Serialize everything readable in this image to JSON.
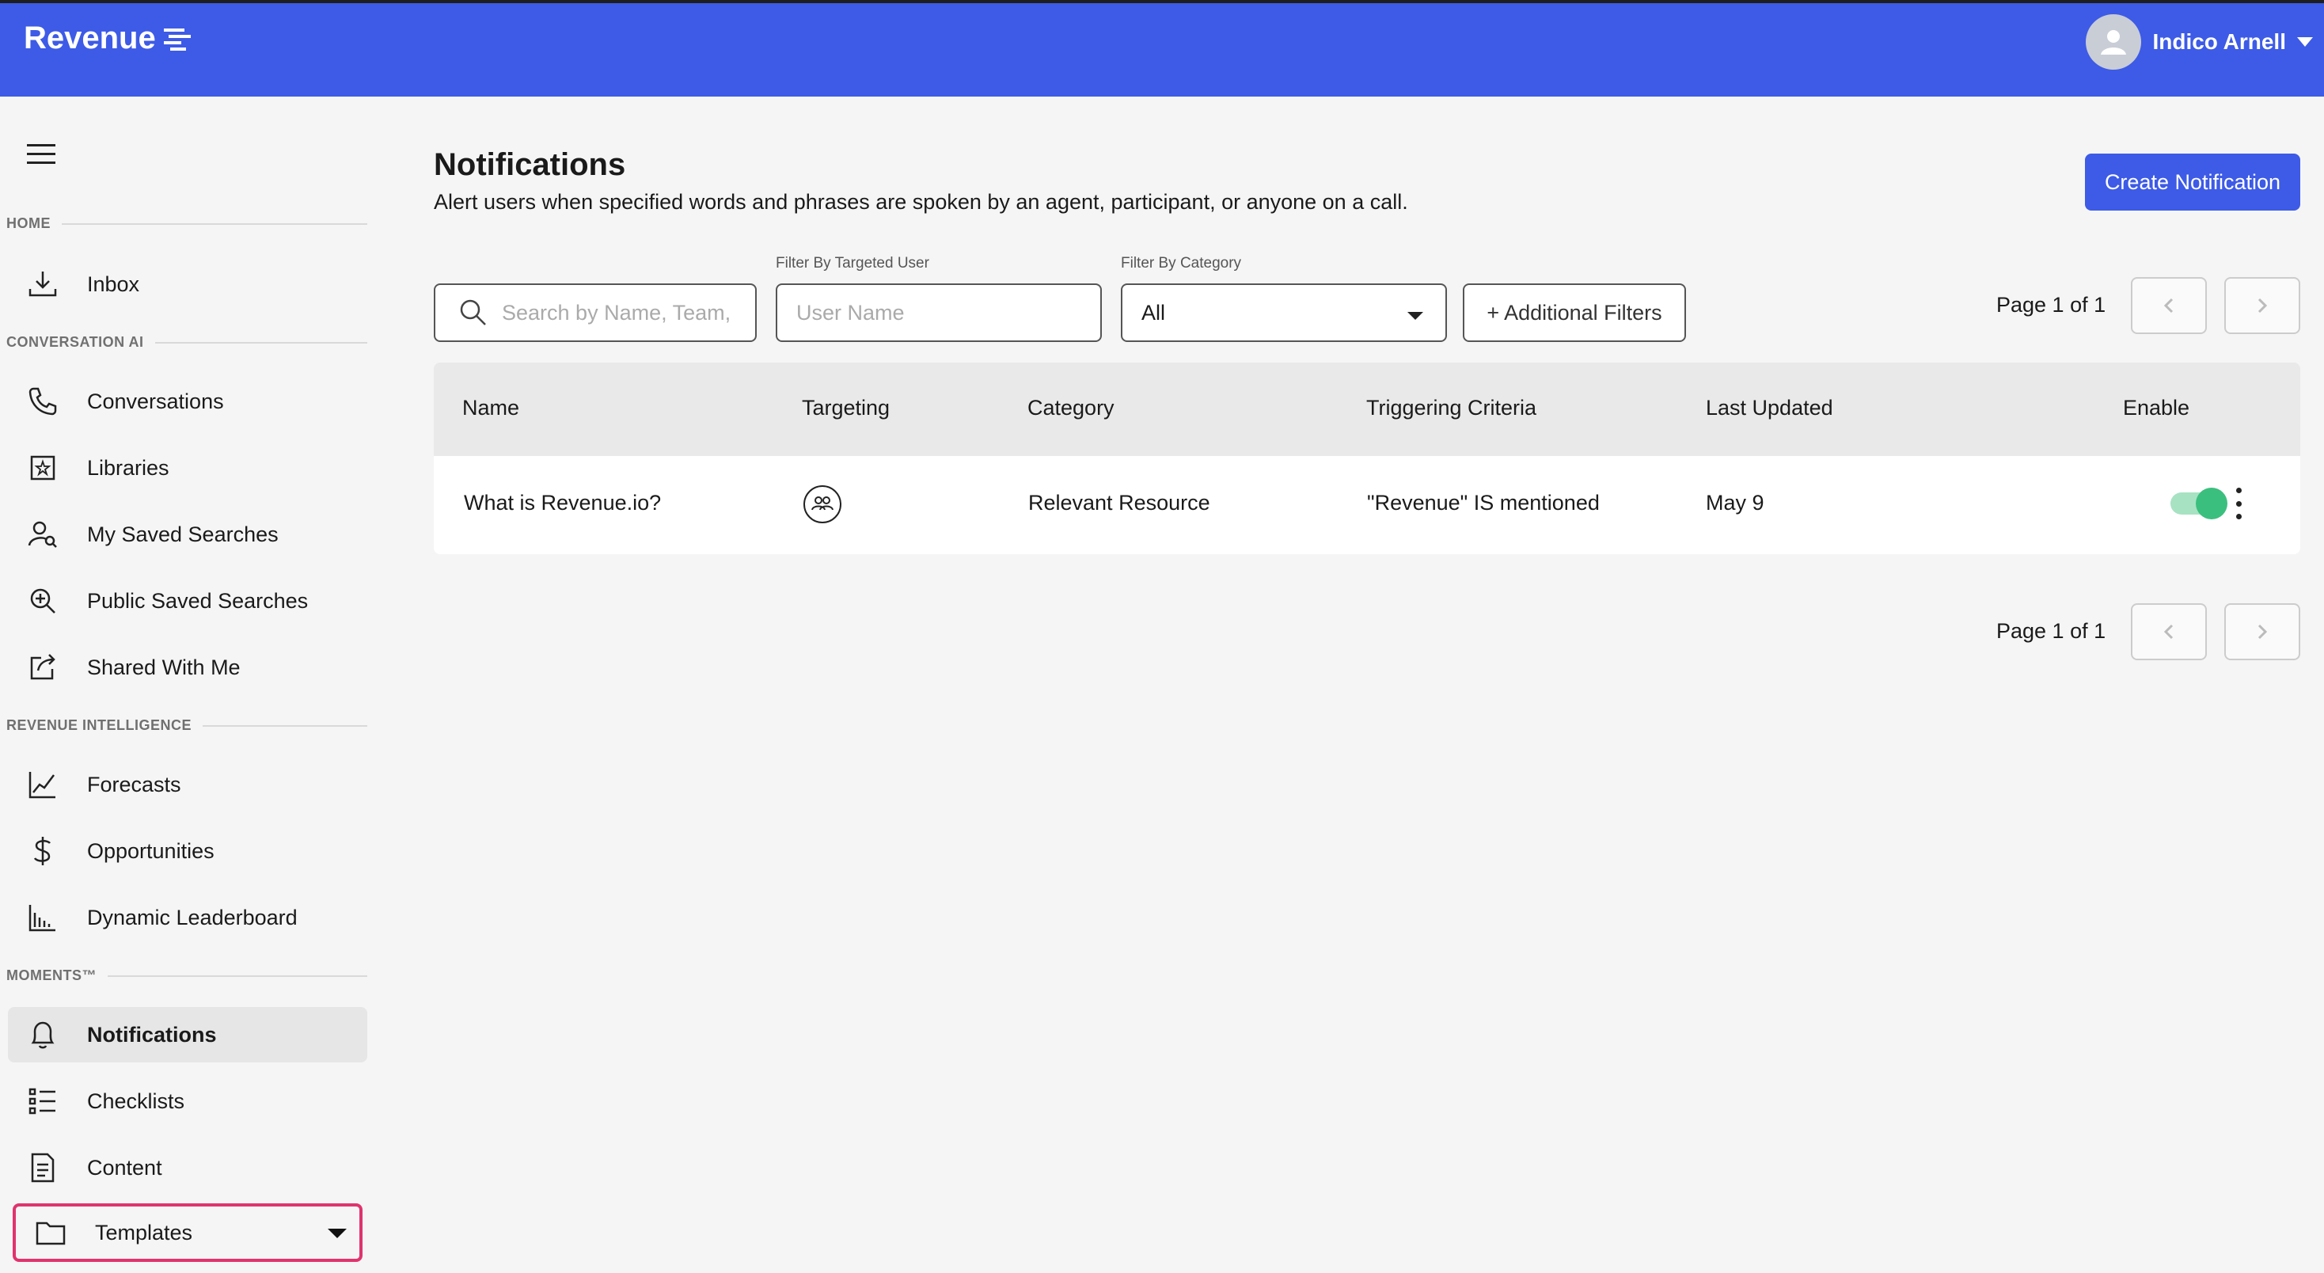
{
  "app": {
    "title": "Revenue"
  },
  "user": {
    "name": "Indico Arnell"
  },
  "sidebar": {
    "sections": [
      {
        "label": "HOME"
      },
      {
        "label": "CONVERSATION AI"
      },
      {
        "label": "REVENUE INTELLIGENCE"
      },
      {
        "label": "MOMENTS™"
      }
    ],
    "items": [
      {
        "label": "Inbox",
        "icon": "inbox-icon"
      },
      {
        "label": "Conversations",
        "icon": "phone-icon"
      },
      {
        "label": "Libraries",
        "icon": "library-icon"
      },
      {
        "label": "My Saved Searches",
        "icon": "user-search-icon"
      },
      {
        "label": "Public Saved Searches",
        "icon": "zoom-in-icon"
      },
      {
        "label": "Shared With Me",
        "icon": "share-icon"
      },
      {
        "label": "Forecasts",
        "icon": "line-chart-icon"
      },
      {
        "label": "Opportunities",
        "icon": "dollar-icon"
      },
      {
        "label": "Dynamic Leaderboard",
        "icon": "bar-chart-icon"
      },
      {
        "label": "Notifications",
        "icon": "bell-icon",
        "active": true
      },
      {
        "label": "Checklists",
        "icon": "checklist-icon"
      },
      {
        "label": "Content",
        "icon": "document-icon"
      },
      {
        "label": "Templates",
        "icon": "folder-icon",
        "highlighted": true
      }
    ]
  },
  "main": {
    "title": "Notifications",
    "description": "Alert users when specified words and phrases are spoken by an agent, participant, or anyone on a call.",
    "create_label": "Create Notification",
    "filters": {
      "search_placeholder": "Search by Name, Team,",
      "targeted_user_label": "Filter By Targeted User",
      "targeted_user_placeholder": "User Name",
      "category_label": "Filter By Category",
      "category_value": "All",
      "additional_filters_label": "+ Additional Filters"
    },
    "pager_top": "Page 1 of 1",
    "pager_bottom": "Page 1 of 1",
    "table": {
      "columns": [
        "Name",
        "Targeting",
        "Category",
        "Triggering Criteria",
        "Last Updated",
        "Enable"
      ],
      "rows": [
        {
          "name": "What is Revenue.io?",
          "targeting_icon": "group-icon",
          "category": "Relevant Resource",
          "criteria": "\"Revenue\" IS mentioned",
          "updated": "May 9",
          "enabled": true
        }
      ]
    }
  },
  "colors": {
    "brand": "#3d5be6",
    "toggle_on": "#3bbf7e",
    "highlight_border": "#e0336e"
  }
}
